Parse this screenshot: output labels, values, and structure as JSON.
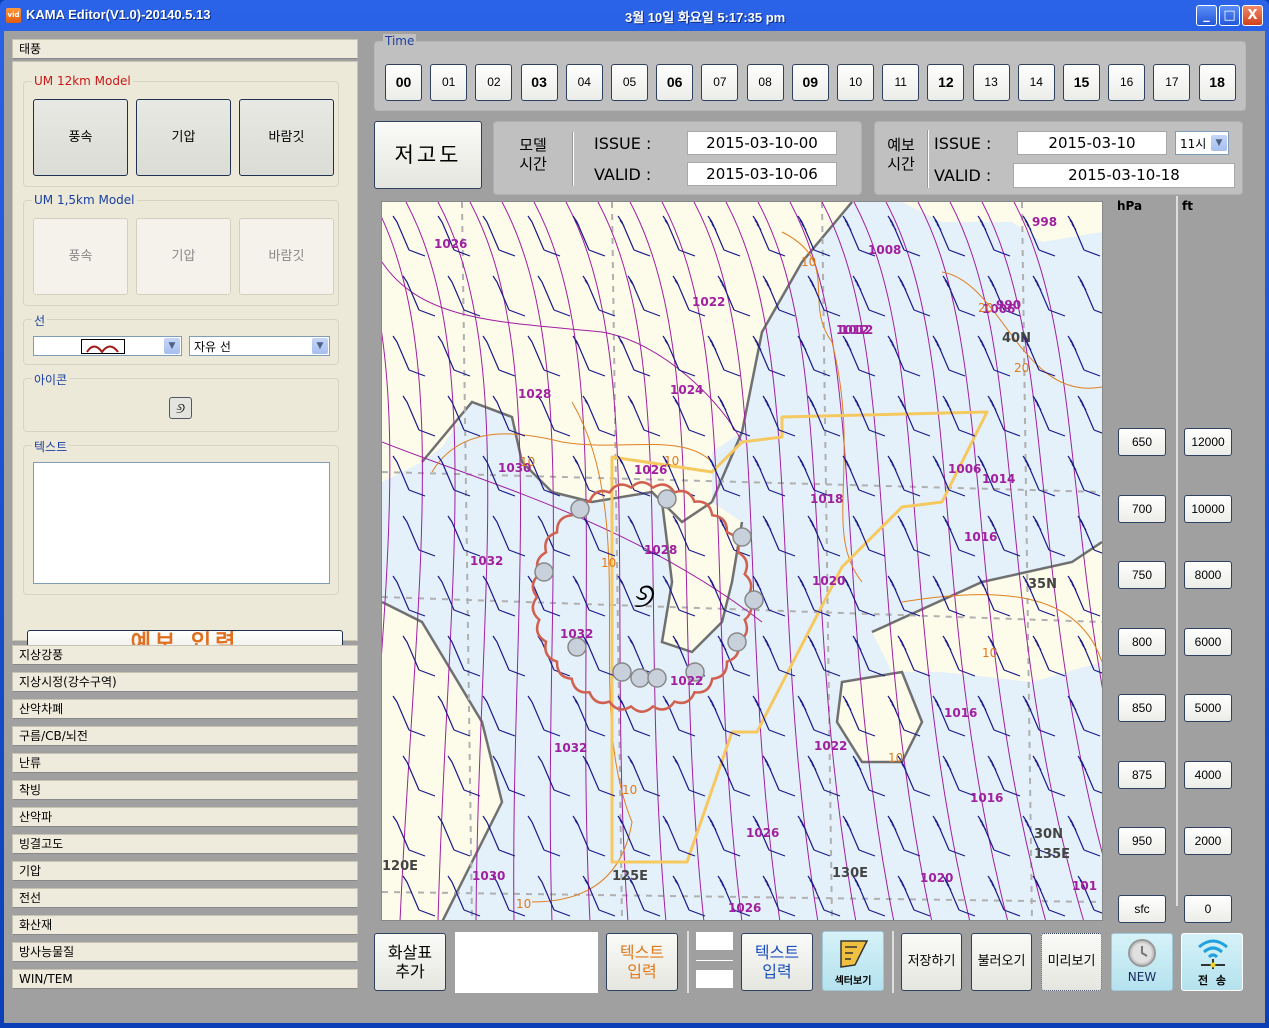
{
  "window": {
    "title": "KAMA Editor(V1.0)-20140.5.13",
    "clock": "3월 10일  화요일  5:17:35 pm",
    "controls": {
      "minimize": "_",
      "maximize": "□",
      "close": "X"
    }
  },
  "left_panel": {
    "typhoon_label": "태풍",
    "um12": {
      "label": "UM 12km Model",
      "buttons": [
        "풍속",
        "기압",
        "바람깃"
      ]
    },
    "um15": {
      "label": "UM 1,5km Model",
      "buttons": [
        "풍속",
        "기압",
        "바람깃"
      ],
      "disabled": true
    },
    "line": {
      "label": "선",
      "style_combo_icon": "warm-front-arc-icon",
      "type_combo_value": "자유 선"
    },
    "icon_group": {
      "label": "아이콘",
      "selected_icon": "typhoon-symbol-icon",
      "glyph": "୬"
    },
    "text_group": {
      "label": "텍스트",
      "value": ""
    },
    "forecast_button": "예보 입력",
    "categories": [
      "지상강풍",
      "지상시정(강수구역)",
      "산악차폐",
      "구름/CB/뇌전",
      "난류",
      "착빙",
      "산악파",
      "빙결고도",
      "기압",
      "전선",
      "화산재",
      "방사능물질",
      "WIN/TEM"
    ]
  },
  "time_bar": {
    "label": "Time",
    "hours": [
      "00",
      "01",
      "02",
      "03",
      "04",
      "05",
      "06",
      "07",
      "08",
      "09",
      "10",
      "11",
      "12",
      "13",
      "14",
      "15",
      "16",
      "17",
      "18"
    ],
    "bold_hours": [
      "00",
      "03",
      "06",
      "09",
      "12",
      "15",
      "18"
    ]
  },
  "chart_type_button": "저고도",
  "model_time": {
    "label": "모델\n시간",
    "label_line1": "모델",
    "label_line2": "시간",
    "issue_label": "ISSUE :",
    "issue_value": "2015-03-10-00",
    "valid_label": "VALID :",
    "valid_value": "2015-03-10-06"
  },
  "forecast_time": {
    "label_line1": "예보",
    "label_line2": "시간",
    "issue_label": "ISSUE :",
    "issue_value": "2015-03-10",
    "hour_select": "11시",
    "valid_label": "VALID :",
    "valid_value": "2015-03-10-18"
  },
  "levels": {
    "hpa_header": "hPa",
    "ft_header": "ft",
    "hpa": [
      "650",
      "700",
      "750",
      "800",
      "850",
      "875",
      "950",
      "sfc"
    ],
    "ft": [
      "12000",
      "10000",
      "8000",
      "6000",
      "5000",
      "4000",
      "2000",
      "0"
    ]
  },
  "map": {
    "colors": {
      "land": "#fdfbea",
      "sea": "#e4f0fa",
      "isobar": "#a020a0",
      "isotach": "#e08020",
      "barb": "#1a1a8a",
      "coast": "#707070",
      "sector": "#f6c860",
      "typhoon_area": "#d06050"
    },
    "isobar_labels": [
      "1026",
      "1028",
      "1030",
      "1032",
      "1024",
      "1022",
      "1026",
      "1018",
      "1020",
      "1022",
      "1016",
      "1012",
      "1008",
      "1012",
      "1014",
      "1016",
      "1006",
      "1006",
      "998",
      "990",
      "1028",
      "1032",
      "1032",
      "1030",
      "1026",
      "1026",
      "1022",
      "1020",
      "1016",
      "101"
    ],
    "isotach_labels": [
      "10",
      "10",
      "10",
      "10",
      "10",
      "10",
      "20",
      "20",
      "10",
      "10"
    ],
    "grid_labels": [
      "40N",
      "35N",
      "30N",
      "120E",
      "125E",
      "130E",
      "135E"
    ],
    "typhoon_symbol": "୬"
  },
  "bottom_toolbar": {
    "arrow_add": [
      "화살표",
      "추가"
    ],
    "text_input_orange": [
      "텍스트",
      "입력"
    ],
    "text_input_blue": [
      "텍스트",
      "입력"
    ],
    "sector_view": "섹터보기",
    "save": "저장하기",
    "load": "불러오기",
    "preview": "미리보기",
    "new": "NEW",
    "transmit": "전  송"
  }
}
